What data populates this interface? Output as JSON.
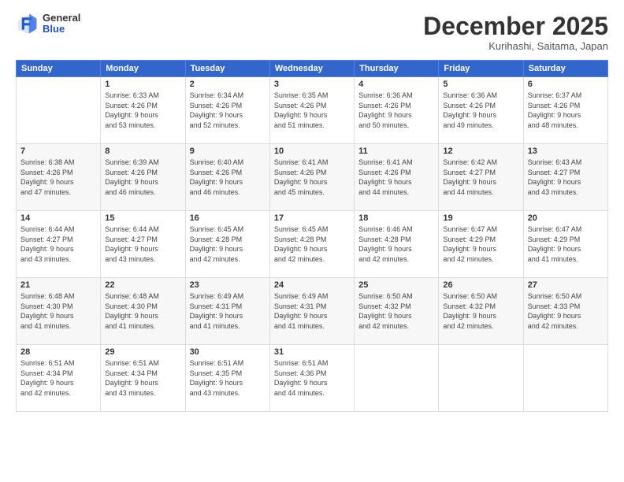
{
  "header": {
    "logo_general": "General",
    "logo_blue": "Blue",
    "month_title": "December 2025",
    "location": "Kurihashi, Saitama, Japan"
  },
  "weekdays": [
    "Sunday",
    "Monday",
    "Tuesday",
    "Wednesday",
    "Thursday",
    "Friday",
    "Saturday"
  ],
  "weeks": [
    [
      {
        "day": "",
        "info": ""
      },
      {
        "day": "1",
        "info": "Sunrise: 6:33 AM\nSunset: 4:26 PM\nDaylight: 9 hours\nand 53 minutes."
      },
      {
        "day": "2",
        "info": "Sunrise: 6:34 AM\nSunset: 4:26 PM\nDaylight: 9 hours\nand 52 minutes."
      },
      {
        "day": "3",
        "info": "Sunrise: 6:35 AM\nSunset: 4:26 PM\nDaylight: 9 hours\nand 51 minutes."
      },
      {
        "day": "4",
        "info": "Sunrise: 6:36 AM\nSunset: 4:26 PM\nDaylight: 9 hours\nand 50 minutes."
      },
      {
        "day": "5",
        "info": "Sunrise: 6:36 AM\nSunset: 4:26 PM\nDaylight: 9 hours\nand 49 minutes."
      },
      {
        "day": "6",
        "info": "Sunrise: 6:37 AM\nSunset: 4:26 PM\nDaylight: 9 hours\nand 48 minutes."
      }
    ],
    [
      {
        "day": "7",
        "info": "Sunrise: 6:38 AM\nSunset: 4:26 PM\nDaylight: 9 hours\nand 47 minutes."
      },
      {
        "day": "8",
        "info": "Sunrise: 6:39 AM\nSunset: 4:26 PM\nDaylight: 9 hours\nand 46 minutes."
      },
      {
        "day": "9",
        "info": "Sunrise: 6:40 AM\nSunset: 4:26 PM\nDaylight: 9 hours\nand 46 minutes."
      },
      {
        "day": "10",
        "info": "Sunrise: 6:41 AM\nSunset: 4:26 PM\nDaylight: 9 hours\nand 45 minutes."
      },
      {
        "day": "11",
        "info": "Sunrise: 6:41 AM\nSunset: 4:26 PM\nDaylight: 9 hours\nand 44 minutes."
      },
      {
        "day": "12",
        "info": "Sunrise: 6:42 AM\nSunset: 4:27 PM\nDaylight: 9 hours\nand 44 minutes."
      },
      {
        "day": "13",
        "info": "Sunrise: 6:43 AM\nSunset: 4:27 PM\nDaylight: 9 hours\nand 43 minutes."
      }
    ],
    [
      {
        "day": "14",
        "info": "Sunrise: 6:44 AM\nSunset: 4:27 PM\nDaylight: 9 hours\nand 43 minutes."
      },
      {
        "day": "15",
        "info": "Sunrise: 6:44 AM\nSunset: 4:27 PM\nDaylight: 9 hours\nand 43 minutes."
      },
      {
        "day": "16",
        "info": "Sunrise: 6:45 AM\nSunset: 4:28 PM\nDaylight: 9 hours\nand 42 minutes."
      },
      {
        "day": "17",
        "info": "Sunrise: 6:45 AM\nSunset: 4:28 PM\nDaylight: 9 hours\nand 42 minutes."
      },
      {
        "day": "18",
        "info": "Sunrise: 6:46 AM\nSunset: 4:28 PM\nDaylight: 9 hours\nand 42 minutes."
      },
      {
        "day": "19",
        "info": "Sunrise: 6:47 AM\nSunset: 4:29 PM\nDaylight: 9 hours\nand 42 minutes."
      },
      {
        "day": "20",
        "info": "Sunrise: 6:47 AM\nSunset: 4:29 PM\nDaylight: 9 hours\nand 41 minutes."
      }
    ],
    [
      {
        "day": "21",
        "info": "Sunrise: 6:48 AM\nSunset: 4:30 PM\nDaylight: 9 hours\nand 41 minutes."
      },
      {
        "day": "22",
        "info": "Sunrise: 6:48 AM\nSunset: 4:30 PM\nDaylight: 9 hours\nand 41 minutes."
      },
      {
        "day": "23",
        "info": "Sunrise: 6:49 AM\nSunset: 4:31 PM\nDaylight: 9 hours\nand 41 minutes."
      },
      {
        "day": "24",
        "info": "Sunrise: 6:49 AM\nSunset: 4:31 PM\nDaylight: 9 hours\nand 41 minutes."
      },
      {
        "day": "25",
        "info": "Sunrise: 6:50 AM\nSunset: 4:32 PM\nDaylight: 9 hours\nand 42 minutes."
      },
      {
        "day": "26",
        "info": "Sunrise: 6:50 AM\nSunset: 4:32 PM\nDaylight: 9 hours\nand 42 minutes."
      },
      {
        "day": "27",
        "info": "Sunrise: 6:50 AM\nSunset: 4:33 PM\nDaylight: 9 hours\nand 42 minutes."
      }
    ],
    [
      {
        "day": "28",
        "info": "Sunrise: 6:51 AM\nSunset: 4:34 PM\nDaylight: 9 hours\nand 42 minutes."
      },
      {
        "day": "29",
        "info": "Sunrise: 6:51 AM\nSunset: 4:34 PM\nDaylight: 9 hours\nand 43 minutes."
      },
      {
        "day": "30",
        "info": "Sunrise: 6:51 AM\nSunset: 4:35 PM\nDaylight: 9 hours\nand 43 minutes."
      },
      {
        "day": "31",
        "info": "Sunrise: 6:51 AM\nSunset: 4:36 PM\nDaylight: 9 hours\nand 44 minutes."
      },
      {
        "day": "",
        "info": ""
      },
      {
        "day": "",
        "info": ""
      },
      {
        "day": "",
        "info": ""
      }
    ]
  ]
}
